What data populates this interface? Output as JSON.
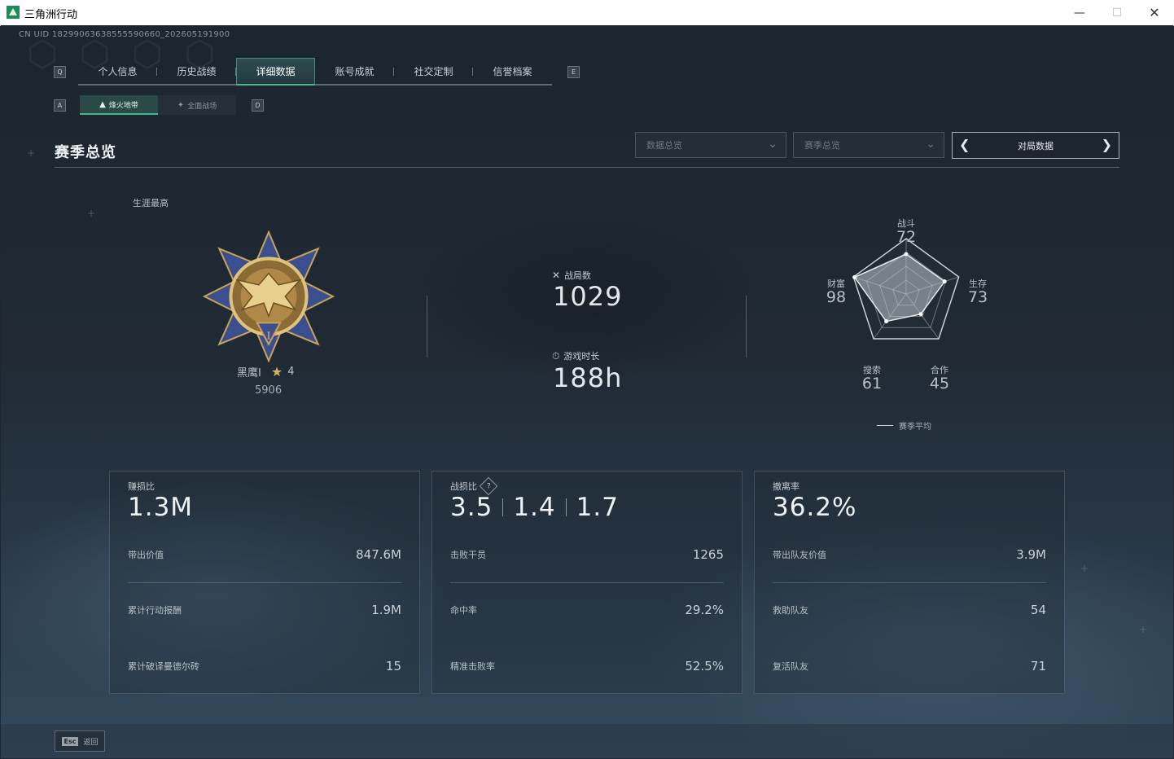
{
  "window": {
    "title": "三角洲行动"
  },
  "uid": "CN UID 18299063638555590660_202605191900",
  "keys": {
    "tab_prev": "Q",
    "tab_next": "E",
    "sub_prev": "A",
    "sub_next": "D"
  },
  "tabs": [
    {
      "label": "个人信息",
      "active": false
    },
    {
      "label": "历史战绩",
      "active": false
    },
    {
      "label": "详细数据",
      "active": true
    },
    {
      "label": "账号成就",
      "active": false
    },
    {
      "label": "社交定制",
      "active": false
    },
    {
      "label": "信誉档案",
      "active": false
    }
  ],
  "subtabs": [
    {
      "label": "烽火地带",
      "active": true,
      "icon": "beacon-icon"
    },
    {
      "label": "全面战场",
      "active": false,
      "icon": "battlefield-icon"
    }
  ],
  "section_title": "赛季总览",
  "filters": {
    "dropdown1": "数据总览",
    "dropdown2": "赛季总览",
    "nav_label": "对局数据"
  },
  "career": {
    "label": "生涯最高",
    "rank_name": "黑鹰Ⅰ",
    "stars": "4",
    "score": "5906"
  },
  "stats": {
    "matches_label": "战局数",
    "matches_value": "1029",
    "playtime_label": "游戏时长",
    "playtime_value": "188h"
  },
  "radar": {
    "axes": [
      {
        "label": "战斗",
        "value": "72"
      },
      {
        "label": "生存",
        "value": "73"
      },
      {
        "label": "合作",
        "value": "45"
      },
      {
        "label": "搜索",
        "value": "61"
      },
      {
        "label": "财富",
        "value": "98"
      }
    ],
    "legend": "赛季平均"
  },
  "cards": [
    {
      "title": "赚损比",
      "big": [
        "1.3M"
      ],
      "rows": [
        {
          "label": "带出价值",
          "value": "847.6M"
        },
        {
          "label": "累计行动报酬",
          "value": "1.9M"
        },
        {
          "label": "累计破译曼德尔砖",
          "value": "15"
        }
      ]
    },
    {
      "title": "战损比",
      "help": "?",
      "big": [
        "3.5",
        "1.4",
        "1.7"
      ],
      "rows": [
        {
          "label": "击败干员",
          "value": "1265"
        },
        {
          "label": "命中率",
          "value": "29.2%"
        },
        {
          "label": "精准击败率",
          "value": "52.5%"
        }
      ]
    },
    {
      "title": "撤离率",
      "big": [
        "36.2%"
      ],
      "rows": [
        {
          "label": "带出队友价值",
          "value": "3.9M"
        },
        {
          "label": "救助队友",
          "value": "54"
        },
        {
          "label": "复活队友",
          "value": "71"
        }
      ]
    }
  ],
  "footer": {
    "esc_key": "Esc",
    "back_label": "返回"
  }
}
